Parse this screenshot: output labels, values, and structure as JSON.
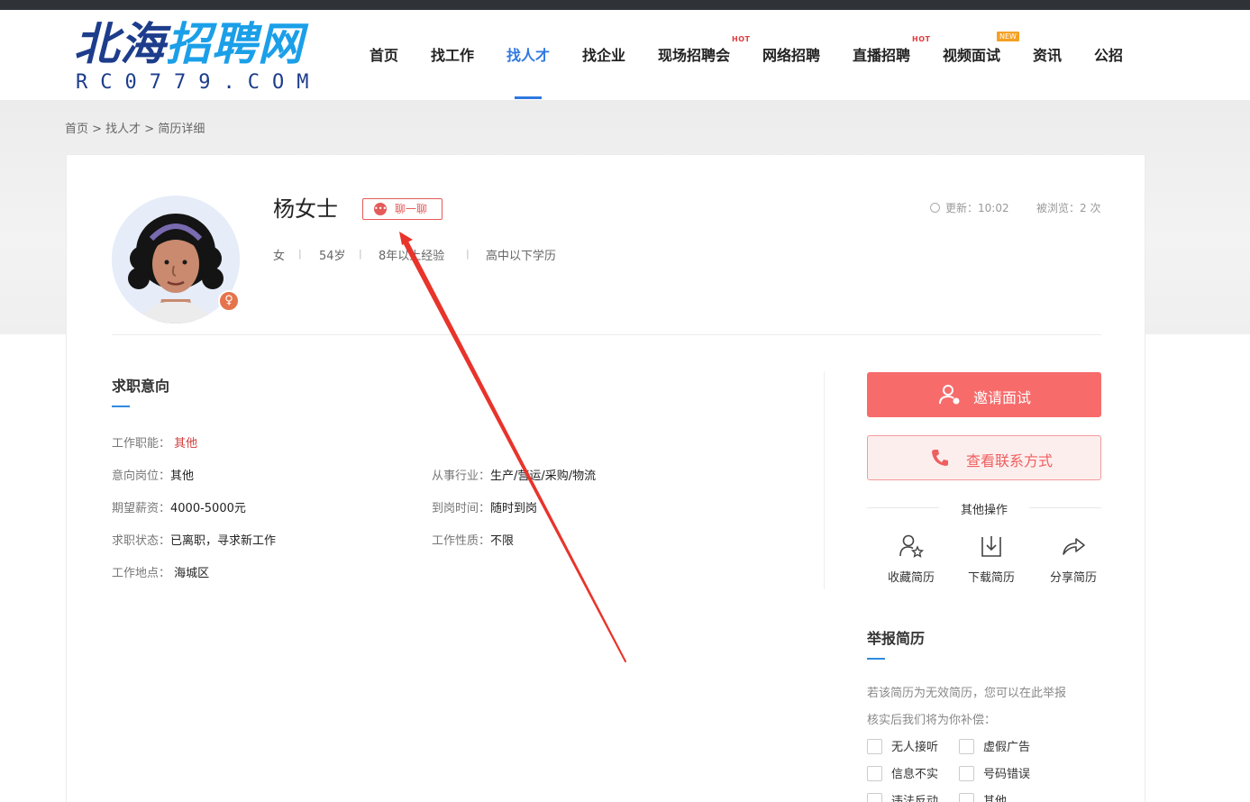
{
  "logo": {
    "main_part1": "北海",
    "main_part2": "招聘网",
    "sub": "RC0779.COM"
  },
  "nav": [
    {
      "label": "首页"
    },
    {
      "label": "找工作"
    },
    {
      "label": "找人才"
    },
    {
      "label": "找企业"
    },
    {
      "label": "现场招聘会",
      "badge": "HOT"
    },
    {
      "label": "网络招聘"
    },
    {
      "label": "直播招聘",
      "badge": "HOT"
    },
    {
      "label": "视频面试",
      "badge": "NEW"
    },
    {
      "label": "资讯"
    },
    {
      "label": "公招"
    }
  ],
  "breadcrumb": "首页 > 找人才 > 简历详细",
  "profile": {
    "name": "杨女士",
    "chat_label": "聊一聊",
    "update_label": "更新：10:02",
    "views_label": "被浏览：2 次",
    "gender": "女",
    "age": "54岁",
    "experience": "8年以上经验",
    "education": "高中以下学历"
  },
  "intent": {
    "title": "求职意向",
    "fields": [
      {
        "key": "工作职能：",
        "value": "其他"
      },
      {
        "key": "意向岗位：",
        "value": "其他"
      },
      {
        "key": "从事行业：",
        "value": "生产/营运/采购/物流"
      },
      {
        "key": "期望薪资：",
        "value": "4000-5000元"
      },
      {
        "key": "到岗时间：",
        "value": "随时到岗"
      },
      {
        "key": "求职状态：",
        "value": "已离职，寻求新工作"
      },
      {
        "key": "工作性质：",
        "value": "不限"
      },
      {
        "key": "工作地点：",
        "value": "海城区"
      }
    ]
  },
  "actions": {
    "invite_label": "邀请面试",
    "contact_label": "查看联系方式",
    "other_title": "其他操作",
    "ops": [
      {
        "label": "收藏简历",
        "icon": "user-star-icon"
      },
      {
        "label": "下载简历",
        "icon": "download-icon"
      },
      {
        "label": "分享简历",
        "icon": "share-icon"
      }
    ]
  },
  "report": {
    "title": "举报简历",
    "desc1": "若该简历为无效简历，您可以在此举报",
    "desc2": "核实后我们将为你补偿：",
    "options": [
      "无人接听",
      "虚假广告",
      "信息不实",
      "号码错误",
      "违法反动",
      "其他"
    ]
  },
  "colors": {
    "accent": "#2f78e0",
    "primary_red": "#f76b6b",
    "chat_red": "#e55a5a"
  }
}
